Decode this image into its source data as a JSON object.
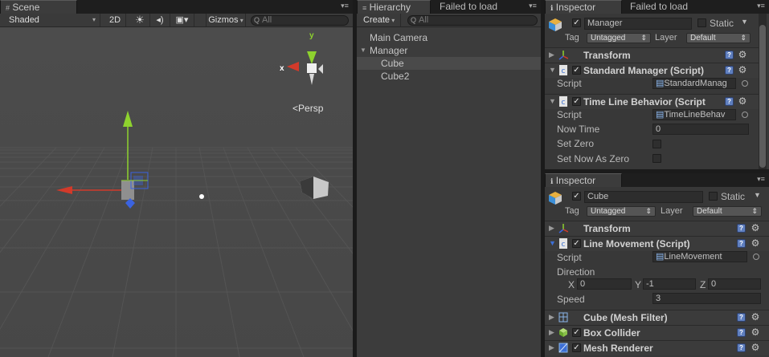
{
  "scene": {
    "tab_label": "Scene",
    "shading_mode": "Shaded",
    "mode_2d": "2D",
    "gizmos_label": "Gizmos",
    "search_placeholder": "All",
    "persp_label": "Persp",
    "axis_y": "y",
    "axis_x": "x"
  },
  "hierarchy": {
    "tab_label": "Hierarchy",
    "second_tab_label": "Failed to load",
    "create_label": "Create",
    "search_placeholder": "All",
    "items": [
      {
        "label": "Main Camera",
        "indent": 0
      },
      {
        "label": "Manager",
        "indent": 0,
        "expanded": true
      },
      {
        "label": "Cube",
        "indent": 1,
        "selected": true
      },
      {
        "label": "Cube2",
        "indent": 1
      }
    ]
  },
  "inspector_top": {
    "tab_label": "Inspector",
    "second_tab_label": "Failed to load",
    "object_name": "Manager",
    "static_label": "Static",
    "tag_label": "Tag",
    "tag_value": "Untagged",
    "layer_label": "Layer",
    "layer_value": "Default",
    "components": [
      {
        "title": "Transform"
      },
      {
        "title": "Standard Manager (Script)",
        "script_label": "Script",
        "script_value": "StandardManag"
      },
      {
        "title": "Time Line Behavior (Script",
        "script_label": "Script",
        "script_value": "TimeLineBehav"
      }
    ],
    "props": {
      "now_time_label": "Now Time",
      "now_time_value": "0",
      "set_zero_label": "Set Zero",
      "set_now_as_zero_label": "Set Now As Zero"
    }
  },
  "inspector_bottom": {
    "tab_label": "Inspector",
    "object_name": "Cube",
    "static_label": "Static",
    "tag_label": "Tag",
    "tag_value": "Untagged",
    "layer_label": "Layer",
    "layer_value": "Default",
    "transform_title": "Transform",
    "line_movement_title": "Line Movement (Script)",
    "script_label": "Script",
    "script_value": "LineMovement",
    "direction_label": "Direction",
    "dir_x_label": "X",
    "dir_x_value": "0",
    "dir_y_label": "Y",
    "dir_y_value": "-1",
    "dir_z_label": "Z",
    "dir_z_value": "0",
    "speed_label": "Speed",
    "speed_value": "3",
    "mesh_filter_title": "Cube (Mesh Filter)",
    "box_collider_title": "Box Collider",
    "mesh_renderer_title": "Mesh Renderer"
  },
  "colors": {
    "accent_blue": "#3d6fd6",
    "axis_red": "#d23a2a",
    "axis_green": "#8ed22e",
    "axis_blue": "#3b63e0"
  }
}
